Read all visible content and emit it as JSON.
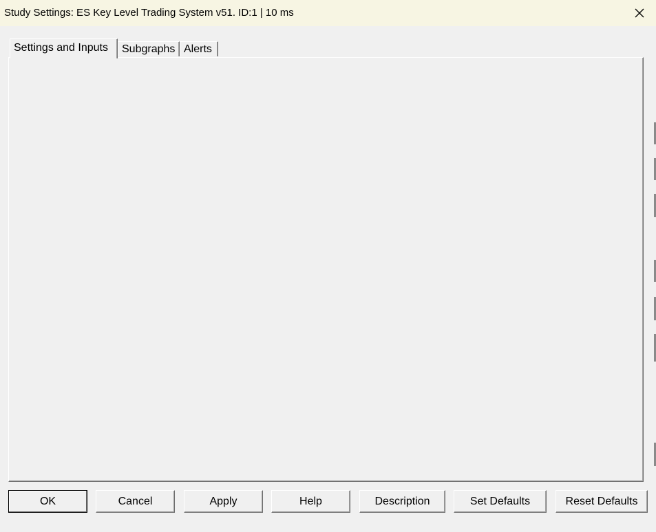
{
  "window": {
    "title": "Study Settings: ES Key Level Trading System v51. ID:1 | 10 ms"
  },
  "tabs": [
    {
      "label": "Settings and Inputs",
      "active": true
    },
    {
      "label": "Subgraphs",
      "active": false
    },
    {
      "label": "Alerts",
      "active": false
    }
  ],
  "buttons": {
    "ok": "OK",
    "cancel": "Cancel",
    "apply": "Apply",
    "help": "Help",
    "description": "Description",
    "set_defaults": "Set Defaults",
    "reset_defaults": "Reset Defaults"
  },
  "icons": {
    "close": "close-icon"
  },
  "colors": {
    "titlebar_bg": "#f7f5e3",
    "window_bg": "#f0f0f0"
  }
}
